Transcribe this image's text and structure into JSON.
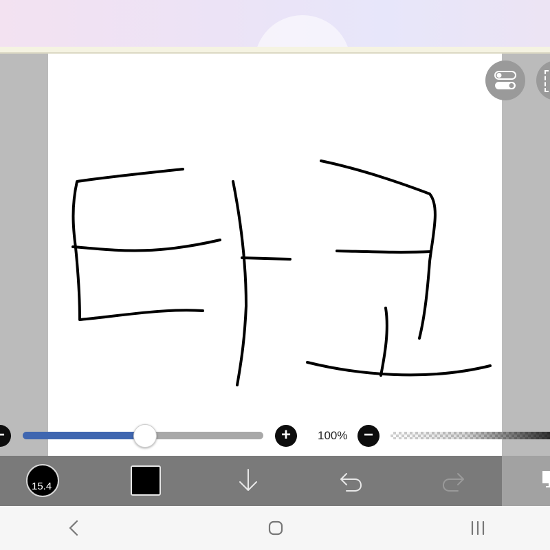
{
  "app": {
    "opacity_percent_label": "100%",
    "brush_size_label": "15.4",
    "brush_size_fraction": 0.505,
    "current_color": "#000000",
    "accent_color": "#3f66b0"
  },
  "icons": {
    "decrease_left": "minus-icon",
    "increase_size": "plus-icon",
    "decrease_opacity": "minus-icon",
    "brush_size": "brush-size-icon",
    "color": "color-swatch",
    "import": "arrow-down-icon",
    "undo": "undo-icon",
    "redo": "redo-icon",
    "layers": "layers-icon",
    "settings": "toggle-settings-icon",
    "frame": "frame-icon",
    "nav_back": "chevron-left-icon",
    "nav_home": "home-icon",
    "nav_recents": "recents-icon"
  }
}
